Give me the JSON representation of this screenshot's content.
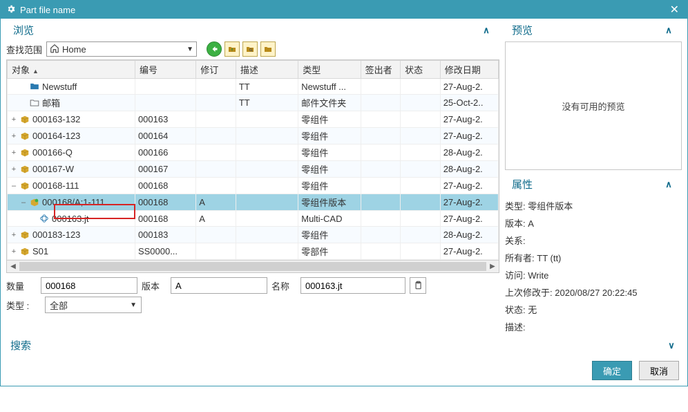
{
  "title": "Part file name",
  "browse": {
    "header": "浏览",
    "searchScopeLabel": "查找范围",
    "location": "Home",
    "columns": [
      "对象",
      "编号",
      "修订",
      "描述",
      "类型",
      "签出者",
      "状态",
      "修改日期"
    ],
    "rows": [
      {
        "lvl": 1,
        "exp": "",
        "icon": "folder",
        "name": "Newstuff",
        "num": "",
        "rev": "",
        "desc": "TT",
        "type": "Newstuff ...",
        "co": "",
        "st": "",
        "date": "27-Aug-2."
      },
      {
        "lvl": 1,
        "exp": "",
        "icon": "mail",
        "name": "邮箱",
        "num": "",
        "rev": "",
        "desc": "TT",
        "type": "邮件文件夹",
        "co": "",
        "st": "",
        "date": "25-Oct-2.."
      },
      {
        "lvl": 0,
        "exp": "+",
        "icon": "box",
        "name": "000163-132",
        "num": "000163",
        "rev": "",
        "desc": "",
        "type": "零组件",
        "co": "",
        "st": "",
        "date": "27-Aug-2."
      },
      {
        "lvl": 0,
        "exp": "+",
        "icon": "box",
        "name": "000164-123",
        "num": "000164",
        "rev": "",
        "desc": "",
        "type": "零组件",
        "co": "",
        "st": "",
        "date": "27-Aug-2."
      },
      {
        "lvl": 0,
        "exp": "+",
        "icon": "box",
        "name": "000166-Q",
        "num": "000166",
        "rev": "",
        "desc": "",
        "type": "零组件",
        "co": "",
        "st": "",
        "date": "28-Aug-2."
      },
      {
        "lvl": 0,
        "exp": "+",
        "icon": "box",
        "name": "000167-W",
        "num": "000167",
        "rev": "",
        "desc": "",
        "type": "零组件",
        "co": "",
        "st": "",
        "date": "28-Aug-2."
      },
      {
        "lvl": 0,
        "exp": "–",
        "icon": "box",
        "name": "000168-111",
        "num": "000168",
        "rev": "",
        "desc": "",
        "type": "零组件",
        "co": "",
        "st": "",
        "date": "27-Aug-2."
      },
      {
        "lvl": 1,
        "exp": "–",
        "icon": "rev",
        "name": "000168/A;1-111",
        "num": "000168",
        "rev": "A",
        "desc": "",
        "type": "零组件版本",
        "co": "",
        "st": "",
        "date": "27-Aug-2.",
        "selected": true
      },
      {
        "lvl": 2,
        "exp": "",
        "icon": "jt",
        "name": "000163.jt",
        "num": "000168",
        "rev": "A",
        "desc": "",
        "type": "Multi-CAD",
        "co": "",
        "st": "",
        "date": "27-Aug-2."
      },
      {
        "lvl": 0,
        "exp": "+",
        "icon": "box",
        "name": "000183-123",
        "num": "000183",
        "rev": "",
        "desc": "",
        "type": "零组件",
        "co": "",
        "st": "",
        "date": "28-Aug-2."
      },
      {
        "lvl": 0,
        "exp": "+",
        "icon": "box",
        "name": "S01",
        "num": "SS0000...",
        "rev": "",
        "desc": "",
        "type": "零部件",
        "co": "",
        "st": "",
        "date": "27-Aug-2."
      }
    ],
    "inputs": {
      "qtyLabel": "数量",
      "qty": "000168",
      "verLabel": "版本",
      "ver": "A",
      "nameLabel": "名称",
      "name": "000163.jt",
      "typeLabel": "类型 :",
      "type": "全部"
    }
  },
  "preview": {
    "header": "预览",
    "placeholder": "没有可用的预览"
  },
  "props": {
    "header": "属性",
    "items": {
      "typeL": "类型:",
      "type": "零组件版本",
      "verL": "版本:",
      "ver": "A",
      "relL": "关系:",
      "rel": "",
      "ownerL": "所有者:",
      "owner": "TT (tt)",
      "accessL": "访问:",
      "access": "Write",
      "modL": "上次修改于:",
      "mod": "2020/08/27 20:22:45",
      "stateL": "状态:",
      "state": "无",
      "descL": "描述:",
      "desc": ""
    }
  },
  "search": {
    "header": "搜索"
  },
  "buttons": {
    "ok": "确定",
    "cancel": "取消"
  }
}
